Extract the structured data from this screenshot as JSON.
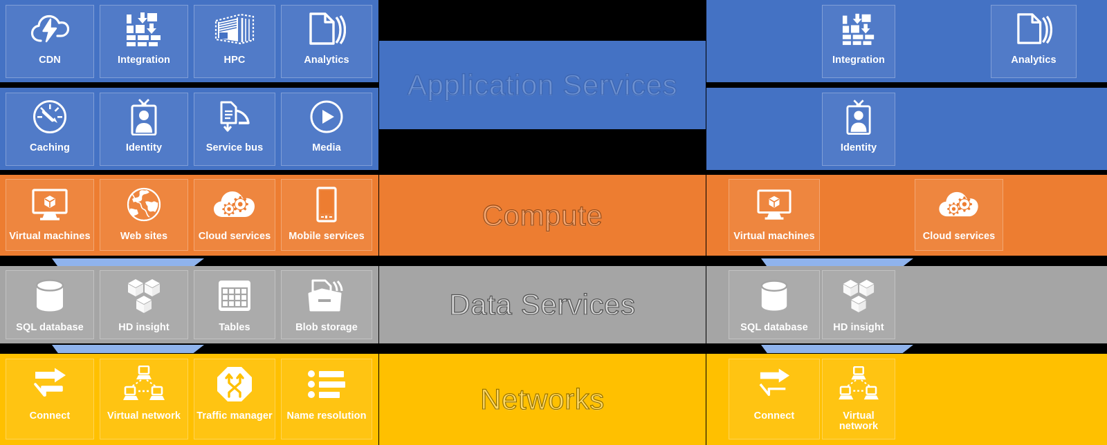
{
  "diagram": {
    "title": "Cloud platform services stack",
    "colors": {
      "application_services": "#4472c4",
      "compute": "#ed7d31",
      "data_services": "#a5a5a5",
      "networks": "#ffc000",
      "connector": "#8fb3ec",
      "background": "#000000",
      "tile_label": "#ffffff"
    },
    "center_labels": {
      "application_services": "Application Services",
      "compute": "Compute",
      "data_services": "Data Services",
      "networks": "Networks"
    }
  },
  "left_panel": {
    "application_services": {
      "row1": [
        {
          "label": "CDN",
          "icon": "cloud-lightning-icon"
        },
        {
          "label": "Integration",
          "icon": "bricks-arrows-icon"
        },
        {
          "label": "HPC",
          "icon": "server-rack-icon"
        },
        {
          "label": "Analytics",
          "icon": "stacked-documents-icon"
        }
      ],
      "row2": [
        {
          "label": "Caching",
          "icon": "gauge-icon"
        },
        {
          "label": "Identity",
          "icon": "id-badge-icon"
        },
        {
          "label": "Service bus",
          "icon": "service-bus-icon"
        },
        {
          "label": "Media",
          "icon": "play-circle-icon"
        }
      ]
    },
    "compute": [
      {
        "label": "Virtual machines",
        "icon": "monitor-box-icon"
      },
      {
        "label": "Web sites",
        "icon": "globe-icon"
      },
      {
        "label": "Cloud services",
        "icon": "cloud-gears-icon"
      },
      {
        "label": "Mobile services",
        "icon": "smartphone-icon"
      }
    ],
    "data_services": [
      {
        "label": "SQL database",
        "icon": "database-cylinder-icon"
      },
      {
        "label": "HD insight",
        "icon": "three-cubes-icon"
      },
      {
        "label": "Tables",
        "icon": "table-grid-icon"
      },
      {
        "label": "Blob storage",
        "icon": "blob-storage-icon"
      }
    ],
    "networks": [
      {
        "label": "Connect",
        "icon": "connect-arrow-icon"
      },
      {
        "label": "Virtual network",
        "icon": "network-computers-icon"
      },
      {
        "label": "Traffic manager",
        "icon": "traffic-octagon-icon"
      },
      {
        "label": "Name resolution",
        "icon": "bullet-list-icon"
      }
    ]
  },
  "right_panel": {
    "application_services": {
      "row1": [
        {
          "label": "Integration",
          "icon": "bricks-arrows-icon"
        },
        {
          "label": "Analytics",
          "icon": "stacked-documents-icon"
        }
      ],
      "row2": [
        {
          "label": "Identity",
          "icon": "id-badge-icon"
        }
      ]
    },
    "compute": [
      {
        "label": "Virtual machines",
        "icon": "monitor-box-icon"
      },
      {
        "label": "Cloud services",
        "icon": "cloud-gears-icon"
      }
    ],
    "data_services": [
      {
        "label": "SQL database",
        "icon": "database-cylinder-icon"
      },
      {
        "label": "HD insight",
        "icon": "three-cubes-icon"
      }
    ],
    "networks": [
      {
        "label": "Connect",
        "icon": "connect-arrow-icon"
      },
      {
        "label": "Virtual network",
        "icon": "network-computers-icon"
      }
    ]
  }
}
